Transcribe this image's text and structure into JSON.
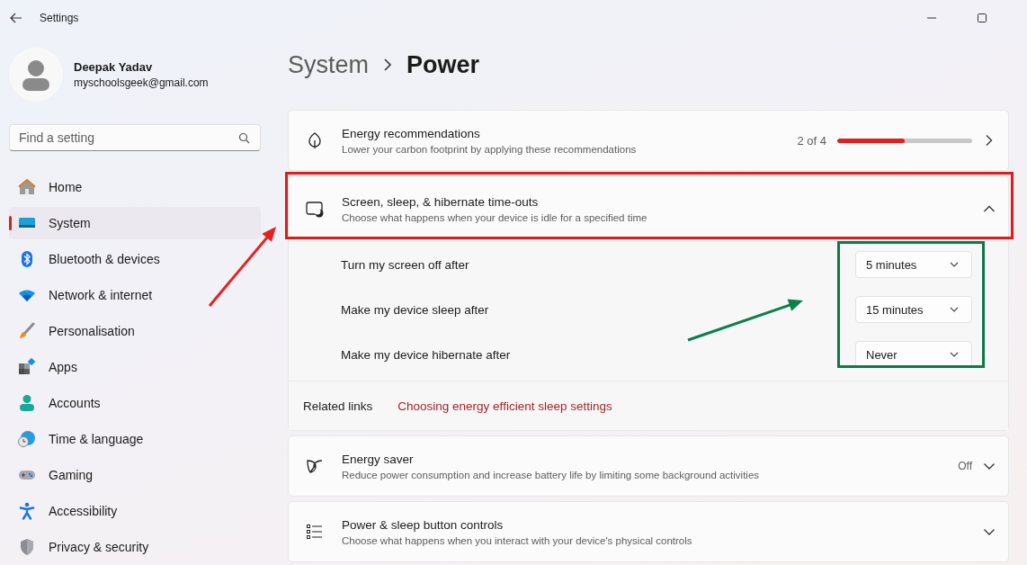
{
  "window": {
    "title": "Settings"
  },
  "profile": {
    "name": "Deepak Yadav",
    "email": "myschoolsgeek@gmail.com"
  },
  "search": {
    "placeholder": "Find a setting"
  },
  "nav": [
    {
      "label": "Home",
      "kind": "home",
      "selected": false
    },
    {
      "label": "System",
      "kind": "system",
      "selected": true
    },
    {
      "label": "Bluetooth & devices",
      "kind": "bluetooth",
      "selected": false
    },
    {
      "label": "Network & internet",
      "kind": "network",
      "selected": false
    },
    {
      "label": "Personalisation",
      "kind": "brush",
      "selected": false
    },
    {
      "label": "Apps",
      "kind": "apps",
      "selected": false
    },
    {
      "label": "Accounts",
      "kind": "accounts",
      "selected": false
    },
    {
      "label": "Time & language",
      "kind": "time",
      "selected": false
    },
    {
      "label": "Gaming",
      "kind": "gaming",
      "selected": false
    },
    {
      "label": "Accessibility",
      "kind": "accessibility",
      "selected": false
    },
    {
      "label": "Privacy & security",
      "kind": "privacy",
      "selected": false
    }
  ],
  "breadcrumb": {
    "parent": "System",
    "current": "Power"
  },
  "cards": [
    {
      "kind": "link",
      "title": "Energy recommendations",
      "subtitle": "Lower your carbon footprint by applying these recommendations",
      "status": "2 of 4",
      "level": 0.5
    },
    {
      "kind": "expander",
      "title": "Screen, sleep, & hibernate time-outs",
      "subtitle": "Choose what happens when your device is idle for a specified time",
      "expanded": true,
      "settings": [
        {
          "label": "Turn my screen off after",
          "value": "5 minutes"
        },
        {
          "label": "Make my device sleep after",
          "value": "15 minutes"
        },
        {
          "label": "Make my device hibernate after",
          "value": "Never"
        }
      ],
      "related_label": "Related links",
      "related_link": "Choosing energy efficient sleep settings"
    },
    {
      "kind": "expander",
      "title": "Energy saver",
      "subtitle": "Reduce power consumption and increase battery life by limiting some background activities",
      "status": "Off",
      "expanded": false
    },
    {
      "kind": "expander",
      "title": "Power & sleep button controls",
      "subtitle": "Choose what happens when you interact with your device's physical controls",
      "expanded": false
    }
  ],
  "annotations": [
    {
      "kind": "box",
      "color": "#e01b1b"
    },
    {
      "kind": "box",
      "color": "#0b7a47"
    },
    {
      "kind": "arrow",
      "color": "#e52222"
    },
    {
      "kind": "arrow",
      "color": "#0c8048"
    }
  ]
}
